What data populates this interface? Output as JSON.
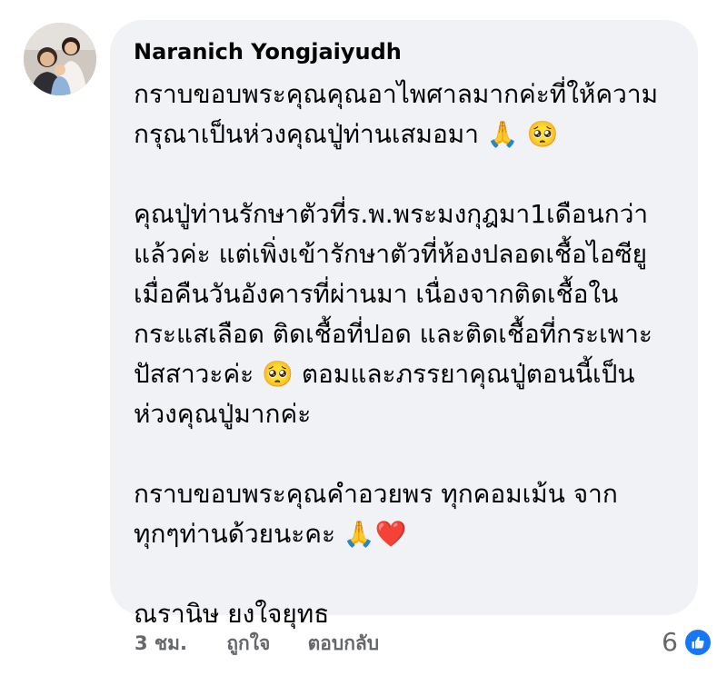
{
  "comment": {
    "author": "Naranich Yongjaiyudh",
    "paragraphs": [
      {
        "lines": [
          "กราบขอบพระคุณคุณอาไพศาลมากค่ะที่ให้ความ",
          "กรุณาเป็นห่วงคุณปู่ท่านเสมอมา 🙏 🥺"
        ]
      },
      {
        "lines": [
          "คุณปู่ท่านรักษาตัวที่ร.พ.พระมงกุฎมา1เดือนกว่า",
          "แล้วค่ะ แต่เพิ่งเข้ารักษาตัวที่ห้องปลอดเชื้อไอซียู",
          "เมื่อคืนวันอังคารที่ผ่านมา เนื่องจากติดเชื้อใน",
          "กระแสเลือด ติดเชื้อที่ปอด และติดเชื้อที่กระเพาะ",
          "ปัสสาวะค่ะ 🥺  ตอมและภรรยาคุณปู่ตอนนี้เป็น",
          "ห่วงคุณปู่มากค่ะ"
        ]
      },
      {
        "lines": [
          "กราบขอบพระคุณคำอวยพร ทุกคอมเม้น จาก",
          "ทุกๆท่านด้วยนะคะ 🙏❤️"
        ]
      },
      {
        "lines": [
          "ณรานิษ ยงใจยุทธ"
        ]
      }
    ]
  },
  "actions": {
    "time": "3 ชม.",
    "like": "ถูกใจ",
    "reply": "ตอบกลับ"
  },
  "reactions": {
    "count": "6",
    "icon": "like-thumb-icon",
    "color": "#1877f2"
  }
}
